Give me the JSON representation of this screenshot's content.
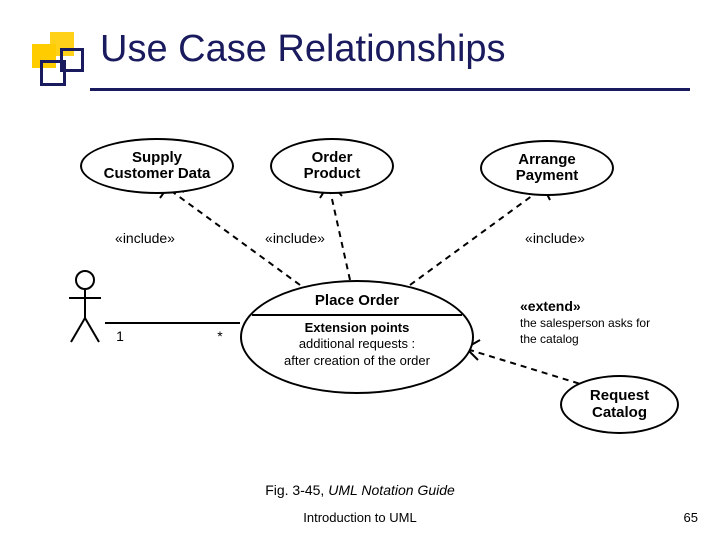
{
  "title": "Use Case Relationships",
  "actor": {
    "left_multiplicity": "1",
    "right_multiplicity": "*"
  },
  "usecases": {
    "supply_customer_data": "Supply\nCustomer Data",
    "order_product": "Order\nProduct",
    "arrange_payment": "Arrange\nPayment",
    "place_order_title": "Place Order",
    "extension_points_label": "Extension points",
    "extension_point_1": "additional requests :",
    "extension_point_2": "after creation of the order",
    "request_catalog": "Request\nCatalog"
  },
  "rel_labels": {
    "include": "«include»",
    "extend": "«extend»",
    "extend_condition_1": "the salesperson asks for",
    "extend_condition_2": "the catalog"
  },
  "caption_fig": "Fig. 3-45,",
  "caption_rest": " UML Notation Guide",
  "footer": "Introduction to UML",
  "page": "65"
}
